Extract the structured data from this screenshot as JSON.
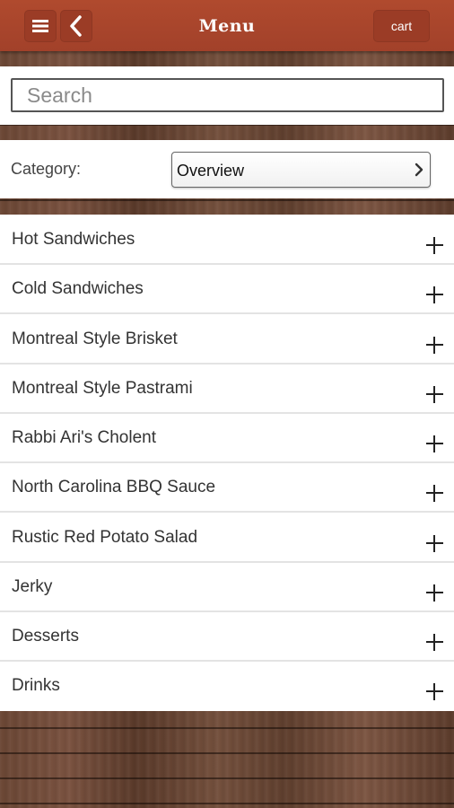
{
  "header": {
    "title": "Menu",
    "cart_label": "cart",
    "menu_icon": "hamburger-icon",
    "back_icon": "chevron-left-icon",
    "bar_color": "#a8452b"
  },
  "search": {
    "placeholder": "Search",
    "value": ""
  },
  "category": {
    "label": "Category:",
    "selected": "Overview",
    "icon": "chevron-right-icon"
  },
  "menu_items": [
    {
      "label": "Hot Sandwiches",
      "icon": "plus-icon"
    },
    {
      "label": "Cold Sandwiches",
      "icon": "plus-icon"
    },
    {
      "label": "Montreal Style Brisket",
      "icon": "plus-icon"
    },
    {
      "label": "Montreal Style Pastrami",
      "icon": "plus-icon"
    },
    {
      "label": "Rabbi Ari's Cholent",
      "icon": "plus-icon"
    },
    {
      "label": "North Carolina BBQ Sauce",
      "icon": "plus-icon"
    },
    {
      "label": "Rustic Red Potato Salad",
      "icon": "plus-icon"
    },
    {
      "label": "Jerky",
      "icon": "plus-icon"
    },
    {
      "label": "Desserts",
      "icon": "plus-icon"
    },
    {
      "label": "Drinks",
      "icon": "plus-icon"
    }
  ]
}
